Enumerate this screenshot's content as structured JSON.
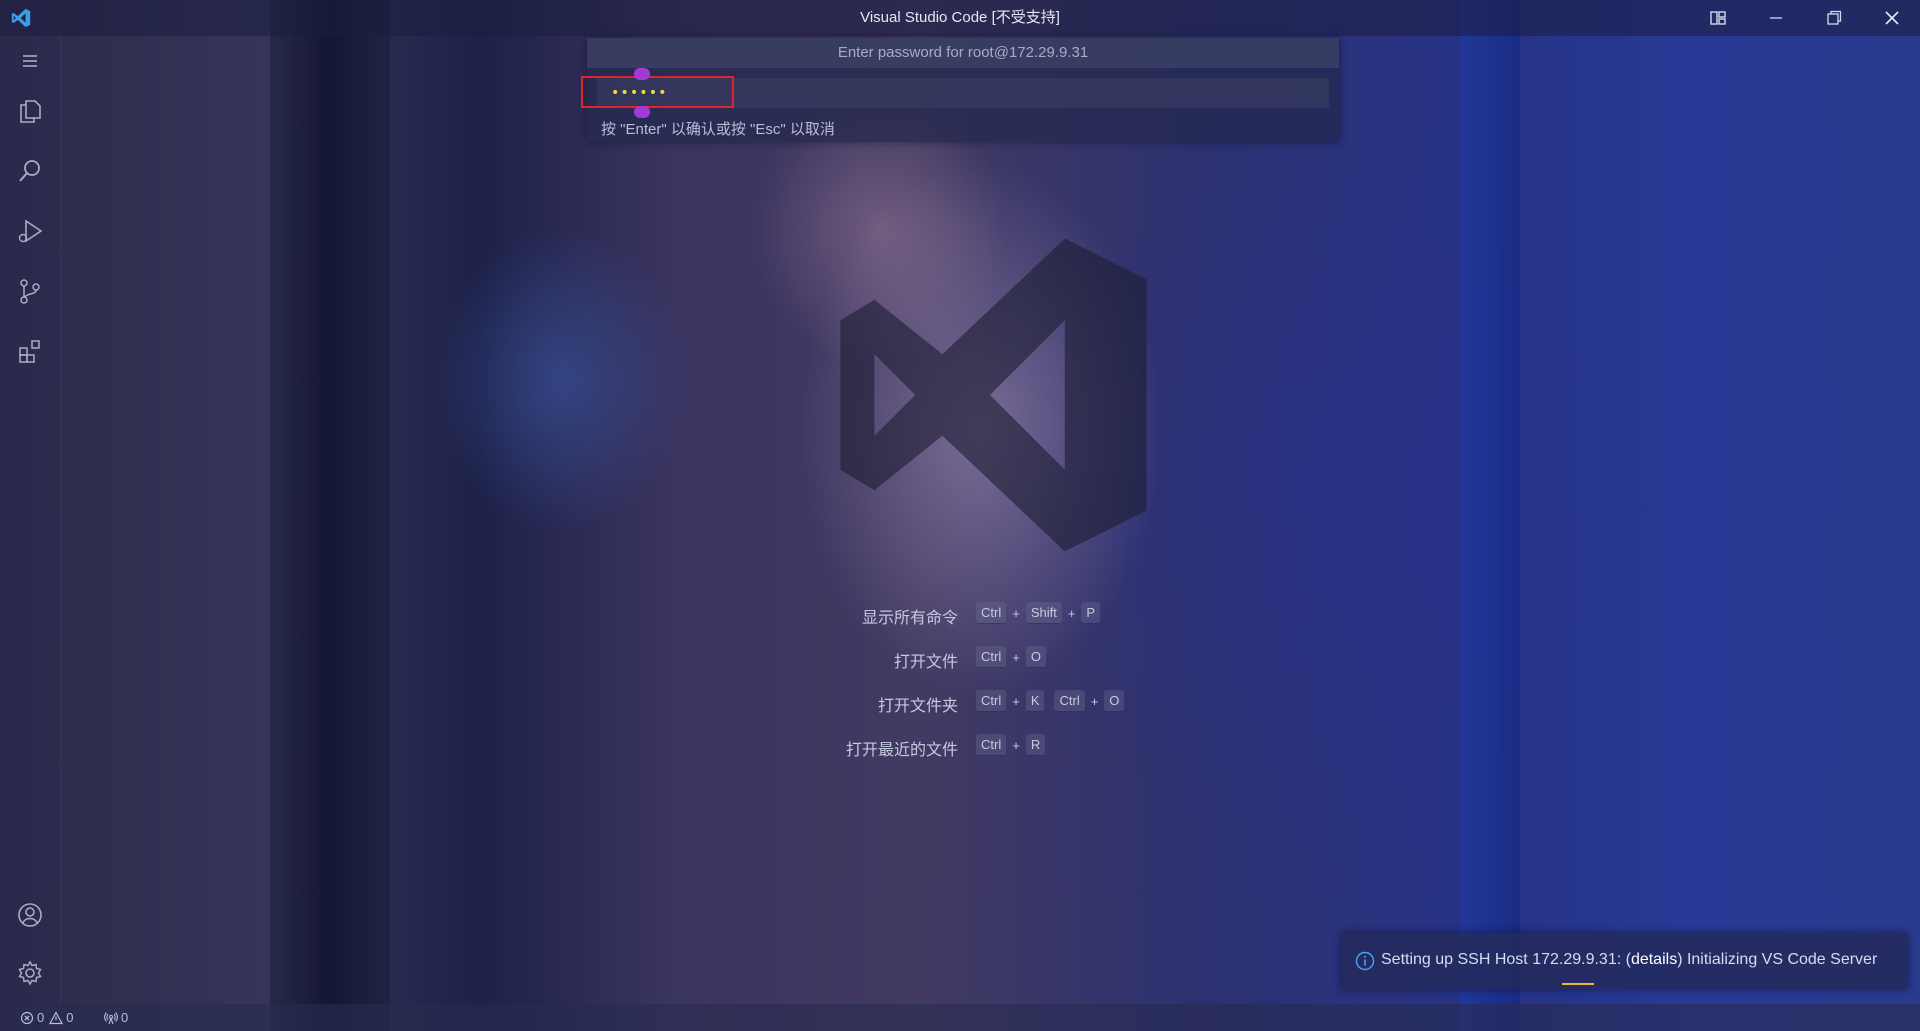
{
  "window": {
    "title": "Visual Studio Code [不受支持]"
  },
  "quick_input": {
    "prompt": "Enter password for root@172.29.9.31",
    "value": "••••••",
    "hint": "按 \"Enter\" 以确认或按 \"Esc\" 以取消"
  },
  "shortcuts": [
    {
      "label": "显示所有命令",
      "keys": [
        [
          "Ctrl",
          "Shift",
          "P"
        ]
      ]
    },
    {
      "label": "打开文件",
      "keys": [
        [
          "Ctrl",
          "O"
        ]
      ]
    },
    {
      "label": "打开文件夹",
      "keys": [
        [
          "Ctrl",
          "K"
        ],
        [
          "Ctrl",
          "O"
        ]
      ]
    },
    {
      "label": "打开最近的文件",
      "keys": [
        [
          "Ctrl",
          "R"
        ]
      ]
    }
  ],
  "notification": {
    "icon": "info-icon",
    "message_prefix": "Setting up SSH Host 172.29.9.31: (",
    "message_link": "details",
    "message_suffix": ") Initializing VS Code Server"
  },
  "statusbar": {
    "errors": "0",
    "warnings": "0",
    "ports": "0"
  },
  "activity_bar": {
    "items": [
      "menu-icon",
      "explorer-icon",
      "search-icon",
      "run-debug-icon",
      "source-control-icon",
      "extensions-icon"
    ],
    "bottom": [
      "accounts-icon",
      "settings-gear-icon"
    ]
  },
  "colors": {
    "accent_password": "#f2d83a",
    "highlight_border": "#e0242c",
    "progress": "#e8b932"
  }
}
